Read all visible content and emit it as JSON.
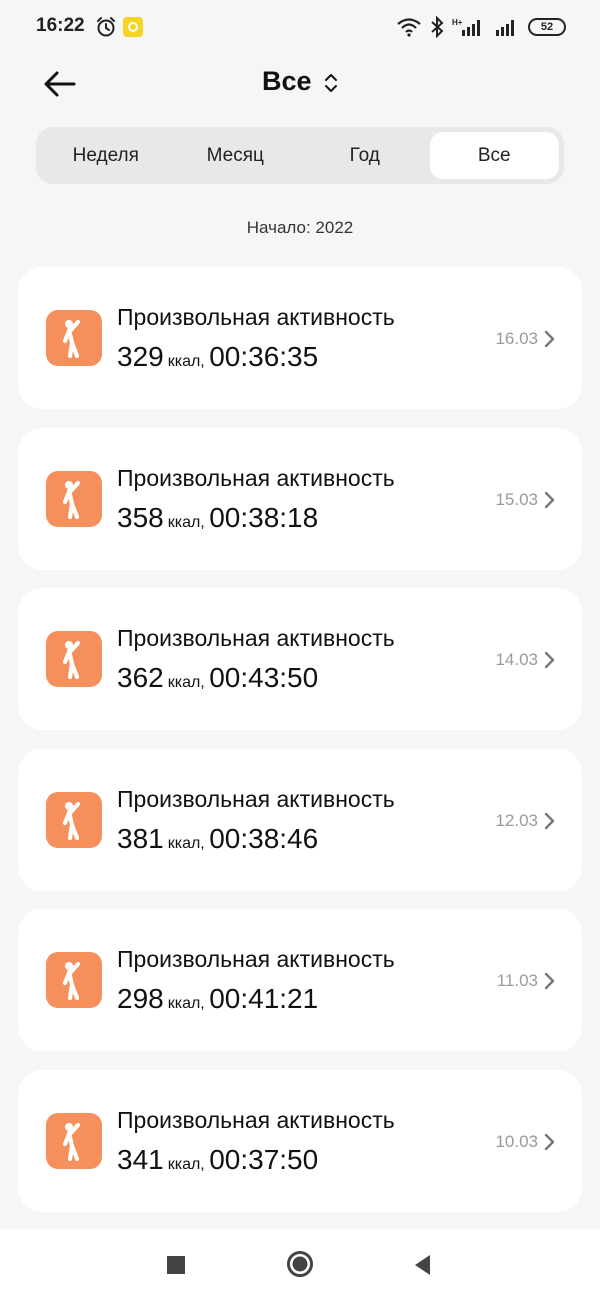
{
  "status": {
    "time": "16:22",
    "battery": "52"
  },
  "header": {
    "title": "Все"
  },
  "tabs": [
    {
      "label": "Неделя",
      "active": false
    },
    {
      "label": "Месяц",
      "active": false
    },
    {
      "label": "Год",
      "active": false
    },
    {
      "label": "Все",
      "active": true
    }
  ],
  "start_label": "Начало: 2022",
  "activities": [
    {
      "title": "Произвольная активность",
      "kcal": "329",
      "unit": "ккал,",
      "duration": "00:36:35",
      "date": "16.03"
    },
    {
      "title": "Произвольная активность",
      "kcal": "358",
      "unit": "ккал,",
      "duration": "00:38:18",
      "date": "15.03"
    },
    {
      "title": "Произвольная активность",
      "kcal": "362",
      "unit": "ккал,",
      "duration": "00:43:50",
      "date": "14.03"
    },
    {
      "title": "Произвольная активность",
      "kcal": "381",
      "unit": "ккал,",
      "duration": "00:38:46",
      "date": "12.03"
    },
    {
      "title": "Произвольная активность",
      "kcal": "298",
      "unit": "ккал,",
      "duration": "00:41:21",
      "date": "11.03"
    },
    {
      "title": "Произвольная активность",
      "kcal": "341",
      "unit": "ккал,",
      "duration": "00:37:50",
      "date": "10.03"
    }
  ],
  "colors": {
    "accent": "#f5905c",
    "background": "#f6f6f6",
    "card": "#ffffff"
  },
  "icons": {
    "activity": "person-stretching-icon",
    "back": "arrow-left-icon"
  }
}
